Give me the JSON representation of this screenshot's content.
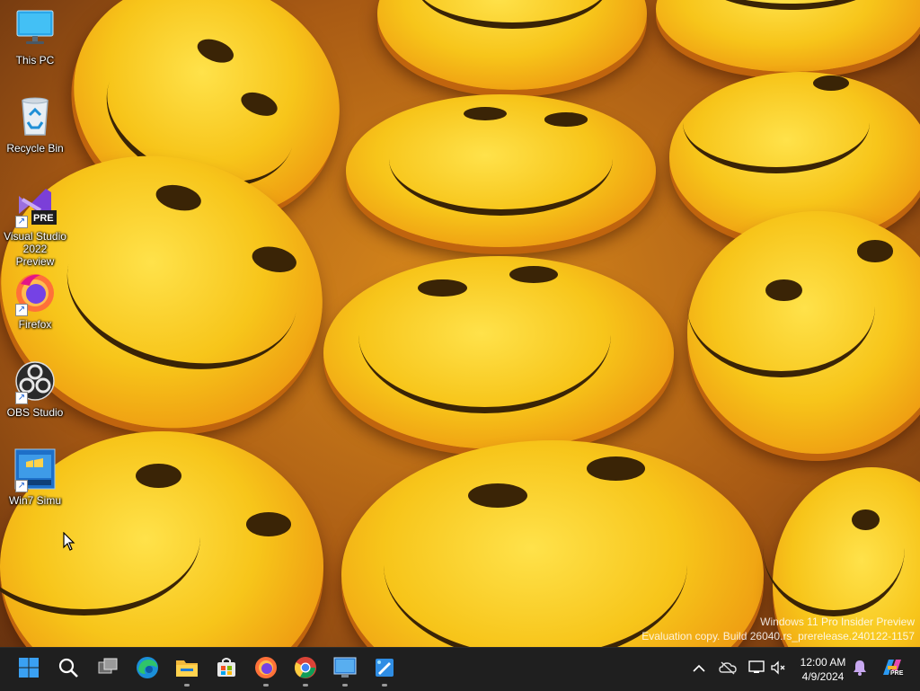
{
  "desktop": {
    "icons": [
      {
        "label": "This PC",
        "icon": "this-pc-icon",
        "shortcut": false
      },
      {
        "label": "Recycle Bin",
        "icon": "recycle-bin-icon",
        "shortcut": false
      },
      {
        "label": "Visual Studio 2022 Preview",
        "icon": "visual-studio-icon",
        "badge": "PRE",
        "shortcut": true
      },
      {
        "label": "Firefox",
        "icon": "firefox-icon",
        "shortcut": true
      },
      {
        "label": "OBS Studio",
        "icon": "obs-studio-icon",
        "shortcut": true
      },
      {
        "label": "Win7 Simu",
        "icon": "win7-simu-icon",
        "shortcut": true
      }
    ],
    "watermark": {
      "line1": "Windows 11 Pro Insider Preview",
      "line2": "Evaluation copy. Build 26040.rs_prerelease.240122-1157"
    }
  },
  "taskbar": {
    "apps": [
      {
        "name": "Start",
        "icon": "windows-start-icon",
        "running": false
      },
      {
        "name": "Search",
        "icon": "search-icon",
        "running": false
      },
      {
        "name": "Task View",
        "icon": "task-view-icon",
        "running": false
      },
      {
        "name": "Microsoft Edge",
        "icon": "edge-icon",
        "running": false
      },
      {
        "name": "File Explorer",
        "icon": "file-explorer-icon",
        "running": true
      },
      {
        "name": "Microsoft Store",
        "icon": "store-icon",
        "running": false
      },
      {
        "name": "Firefox",
        "icon": "firefox-icon",
        "running": true
      },
      {
        "name": "Google Chrome",
        "icon": "chrome-icon",
        "running": true
      },
      {
        "name": "Win7 Simu",
        "icon": "win7-simu-icon",
        "running": true
      },
      {
        "name": "Paint",
        "icon": "paint-icon",
        "running": true
      }
    ],
    "tray": {
      "time": "12:00 AM",
      "date": "4/9/2024",
      "copilot_badge": "PRE"
    }
  },
  "colors": {
    "taskbar_bg": "#1f1f1f",
    "accent": "#0078d4",
    "wallpaper_yellow": "#f7c51a"
  }
}
